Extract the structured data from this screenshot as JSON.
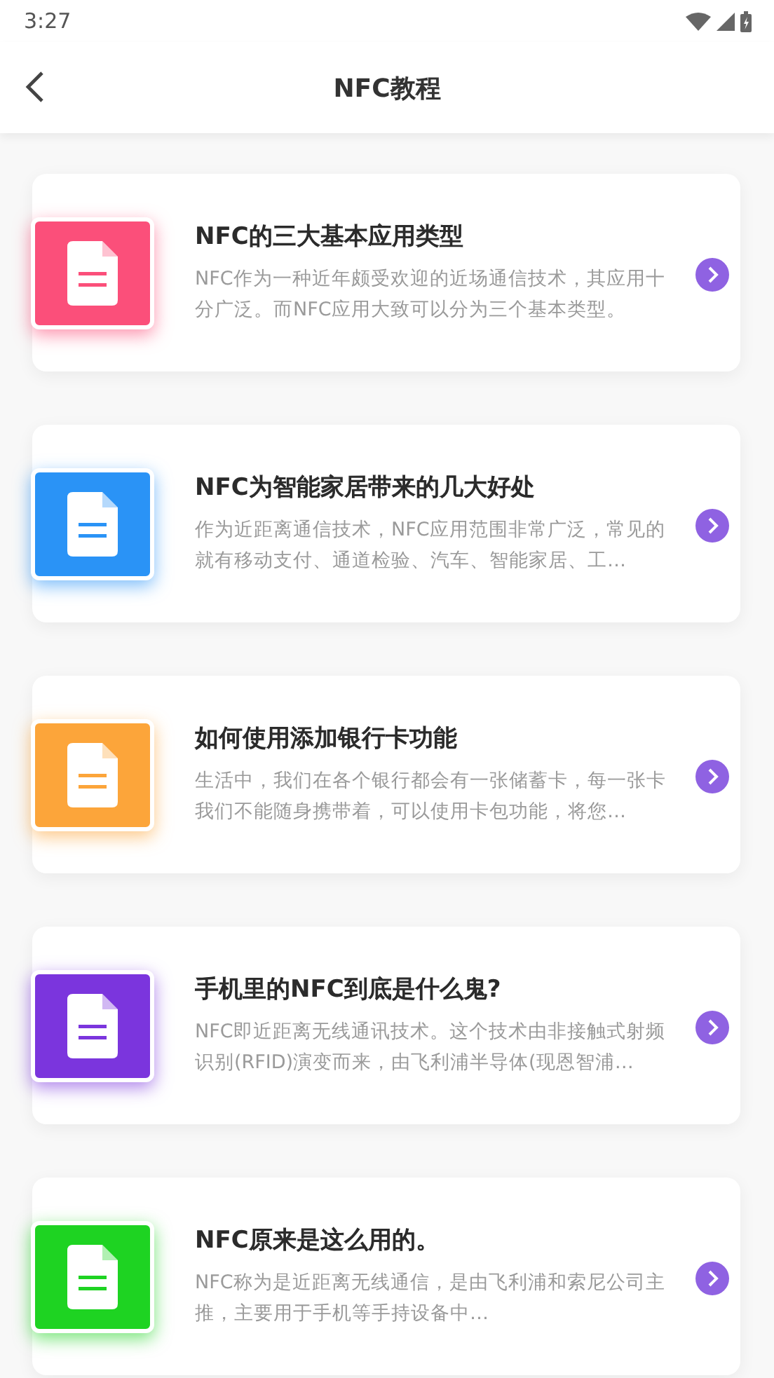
{
  "status_bar": {
    "time": "3:27"
  },
  "header": {
    "title": "NFC教程"
  },
  "articles": [
    {
      "title": "NFC的三大基本应用类型",
      "summary": "NFC作为一种近年颇受欢迎的近场通信技术，其应用十分广泛。而NFC应用大致可以分为三个基本类型。",
      "color": "#fb4f7a"
    },
    {
      "title": "NFC为智能家居带来的几大好处",
      "summary": "作为近距离通信技术，NFC应用范围非常广泛，常见的就有移动支付、通道检验、汽车、智能家居、工…",
      "color": "#2a93f6"
    },
    {
      "title": "如何使用添加银行卡功能",
      "summary": "生活中，我们在各个银行都会有一张储蓄卡，每一张卡我们不能随身携带着，可以使用卡包功能，将您…",
      "color": "#fca53a"
    },
    {
      "title": "手机里的NFC到底是什么鬼?",
      "summary": "NFC即近距离无线通讯技术。这个技术由非接触式射频识别(RFID)演变而来，由飞利浦半导体(现恩智浦…",
      "color": "#7b35dd"
    },
    {
      "title": "NFC原来是这么用的。",
      "summary": "NFC称为是近距离无线通信，是由飞利浦和索尼公司主推，主要用于手机等手持设备中…",
      "color": "#1ed322"
    }
  ]
}
